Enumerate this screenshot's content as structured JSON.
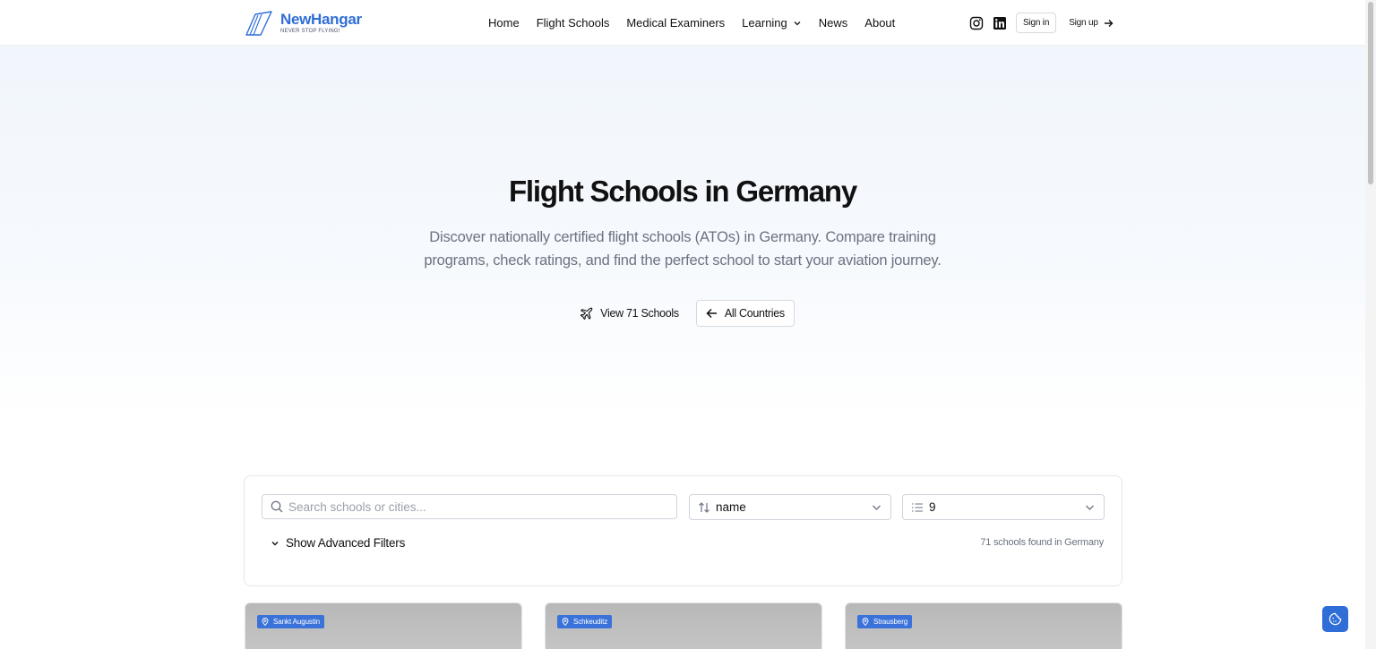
{
  "brand": {
    "name": "NewHangar",
    "tagline": "NEVER STOP FLYING!"
  },
  "nav": {
    "items": [
      {
        "label": "Home"
      },
      {
        "label": "Flight Schools"
      },
      {
        "label": "Medical Examiners"
      },
      {
        "label": "Learning",
        "has_dropdown": true
      },
      {
        "label": "News"
      },
      {
        "label": "About"
      }
    ],
    "social": [
      "instagram-icon",
      "linkedin-icon"
    ],
    "signin_label": "Sign in",
    "signup_label": "Sign up"
  },
  "hero": {
    "title": "Flight Schools in Germany",
    "description": "Discover nationally certified flight schools (ATOs) in Germany. Compare training programs, check ratings, and find the perfect school to start your aviation journey.",
    "view_label": "View 71 Schools",
    "all_countries_label": "All Countries"
  },
  "filters": {
    "search_placeholder": "Search schools or cities...",
    "sort_value": "name",
    "per_page_value": "9",
    "advanced_label": "Show Advanced Filters",
    "results_text": "71 schools found in Germany"
  },
  "cards": [
    {
      "location": "Sankt Augustin"
    },
    {
      "location": "Schkeuditz"
    },
    {
      "location": "Strausberg"
    }
  ],
  "colors": {
    "brand": "#2f6ed6",
    "badge": "#3b72d9",
    "muted": "#6b7280"
  }
}
